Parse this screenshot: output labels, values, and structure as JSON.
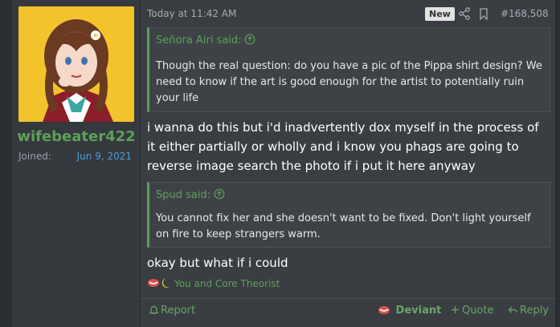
{
  "user": {
    "username": "wifebeater422",
    "joined_label": "Joined:",
    "joined_value": "Jun 9, 2021"
  },
  "post": {
    "timestamp": "Today at 11:42 AM",
    "new_badge": "New",
    "post_number": "#168,508",
    "quote1": {
      "author": "Señora Airi said:",
      "text": "Though the real question: do you have a pic of the Pippa shirt design? We need to know if the art is good enough for the artist to potentially ruin your life"
    },
    "text1": "i wanna do this but i'd inadvertently dox myself in the process of it either partially or wholly and i know you phags are going to reverse image search the photo if i put it here anyway",
    "quote2": {
      "author": "Spud said:",
      "text": "You cannot fix her and she doesn't want to be fixed. Don't light yourself on fire to keep strangers warm."
    },
    "text2": "okay but what if i could",
    "reactions": "You and Core Theorist"
  },
  "footer": {
    "report": "Report",
    "deviant": "Deviant",
    "quote": "Quote",
    "reply": "Reply"
  },
  "colors": {
    "accent_green": "#5da05a",
    "link_blue": "#4aa0d8",
    "background": "#3a3d42"
  }
}
